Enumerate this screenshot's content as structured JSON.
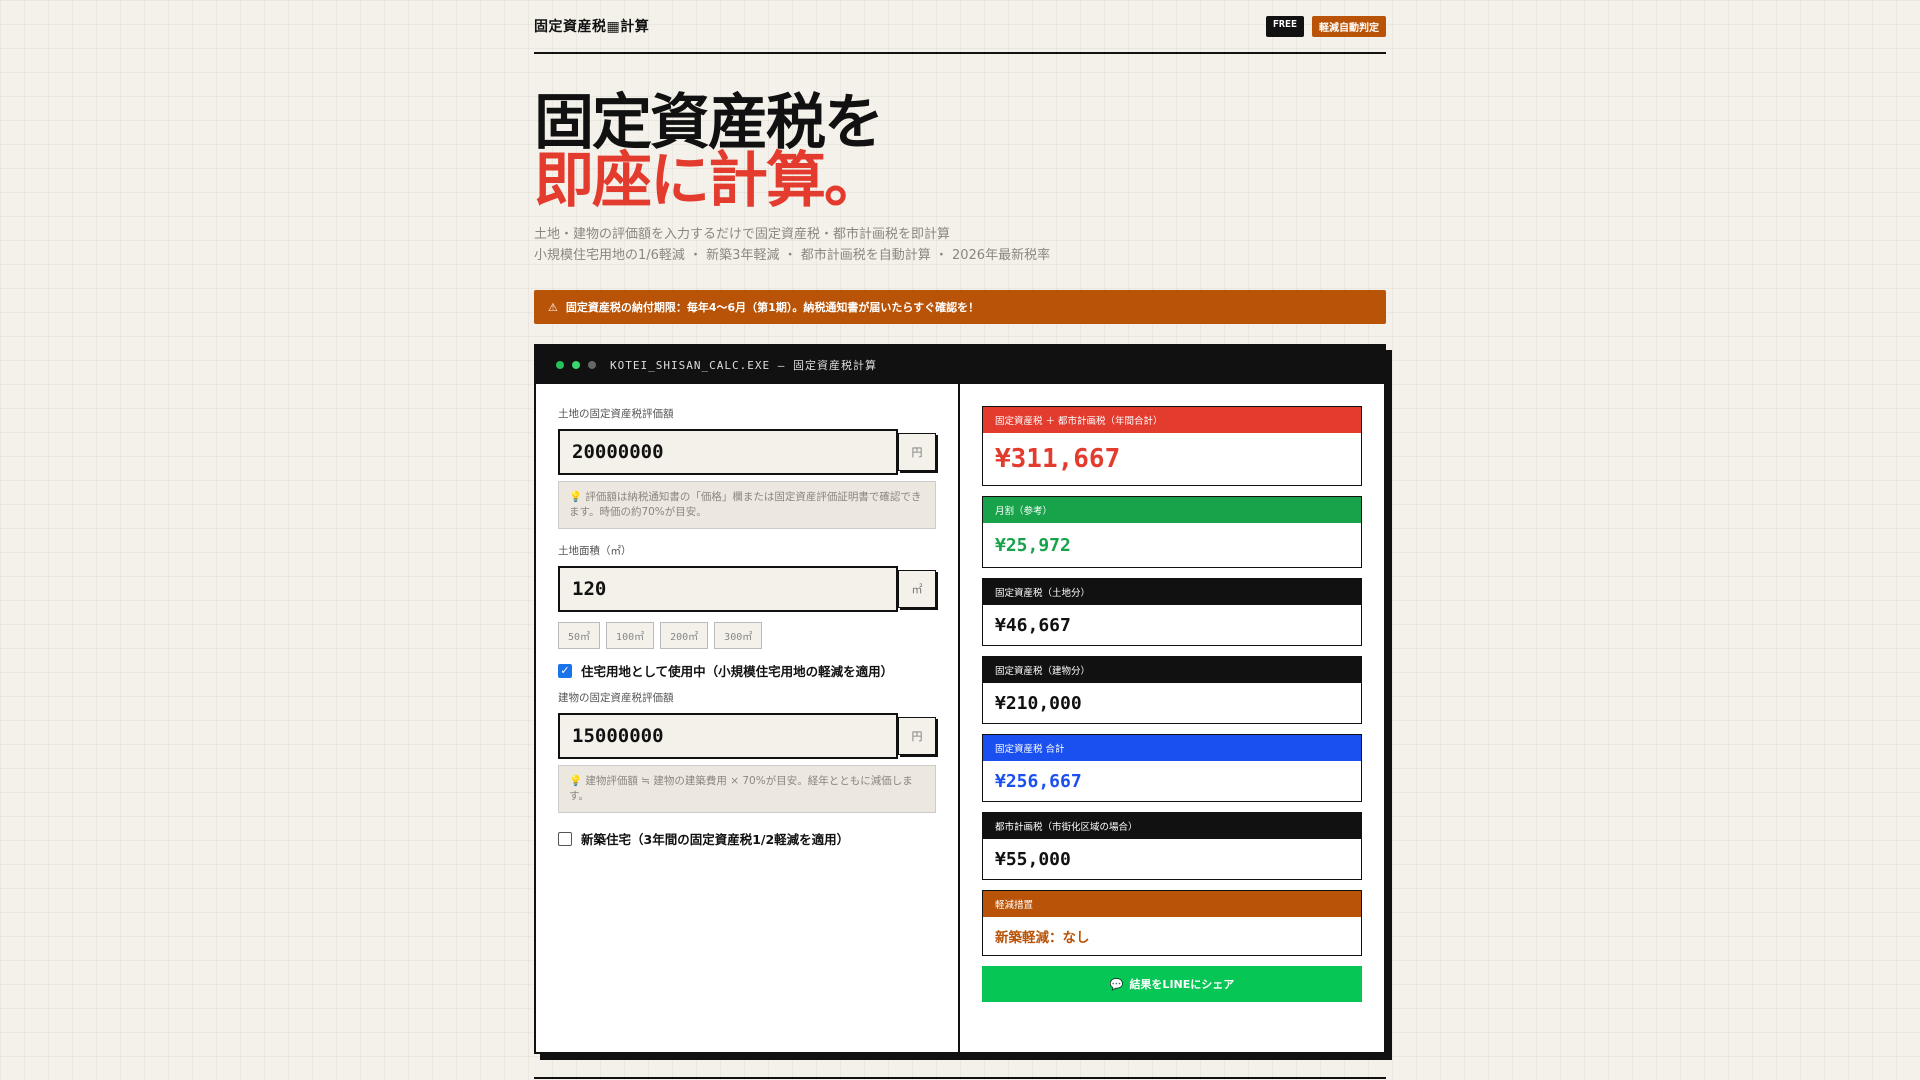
{
  "header": {
    "brand": "固定資産税▦計算",
    "badge_free": "FREE",
    "badge_auto": "軽減自動判定"
  },
  "hero": {
    "line1": "固定資産税を",
    "line2": "即座に計算。",
    "sub1": "土地・建物の評価額を入力するだけで固定資産税・都市計画税を即計算",
    "sub2": "小規模住宅用地の1/6軽減 ・ 新築3年軽減 ・ 都市計画税を自動計算 ・ 2026年最新税率"
  },
  "notice": {
    "icon": "⚠",
    "text": "固定資産税の納付期限：毎年4〜6月（第1期）。納税通知書が届いたらすぐ確認を！"
  },
  "window": {
    "title": "KOTEI_SHISAN_CALC.EXE — 固定資産税計算"
  },
  "form": {
    "land_value_label": "土地の固定資産税評価額",
    "land_value": "20000000",
    "land_value_unit": "円",
    "land_hint": "💡 評価額は納税通知書の「価格」欄または固定資産評価証明書で確認できます。時価の約70%が目安。",
    "land_area_label": "土地面積（㎡）",
    "land_area": "120",
    "land_area_unit": "㎡",
    "presets": [
      "50㎡",
      "100㎡",
      "200㎡",
      "300㎡"
    ],
    "residential_label": "住宅用地として使用中（小規模住宅用地の軽減を適用）",
    "residential_checked": true,
    "building_value_label": "建物の固定資産税評価額",
    "building_value": "15000000",
    "building_value_unit": "円",
    "building_hint": "💡 建物評価額 ≒ 建物の建築費用 × 70%が目安。経年とともに減価します。",
    "new_build_label": "新築住宅（3年間の固定資産税1/2軽減を適用）",
    "new_build_checked": false
  },
  "results": {
    "total_label": "固定資産税 ＋ 都市計画税（年間合計）",
    "total_value": "¥311,667",
    "monthly_label": "月割（参考）",
    "monthly_value": "¥25,972",
    "land_tax_label": "固定資産税（土地分）",
    "land_tax_value": "¥46,667",
    "building_tax_label": "固定資産税（建物分）",
    "building_tax_value": "¥210,000",
    "property_tax_total_label": "固定資産税 合計",
    "property_tax_total_value": "¥256,667",
    "city_tax_label": "都市計画税（市街化区域の場合）",
    "city_tax_value": "¥55,000",
    "reduction_label": "軽減措置",
    "reduction_value": "新築軽減：なし",
    "share_icon": "💬",
    "share_label": "結果をLINEにシェア"
  },
  "colors": {
    "accent_red": "#e33b2e",
    "accent_orange": "#b85307",
    "accent_green": "#18a34a",
    "accent_blue": "#1a4ff0",
    "line_green": "#06c755"
  }
}
